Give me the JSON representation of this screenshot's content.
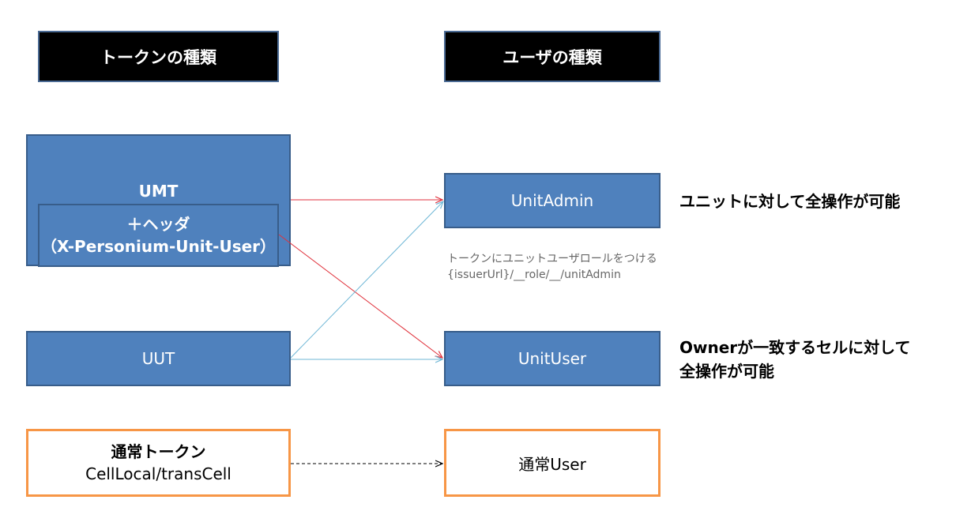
{
  "headers": {
    "token_types": "トークンの種類",
    "user_types": "ユーザの種類"
  },
  "tokens": {
    "umt": {
      "label": "UMT",
      "header_label": "＋ヘッダ",
      "header_name": "（X-Personium-Unit-User）"
    },
    "uut": {
      "label": "UUT"
    },
    "normal": {
      "label": "通常トークン",
      "sub_label": "CellLocal/transCell"
    }
  },
  "users": {
    "unit_admin": "UnitAdmin",
    "unit_user": "UnitUser",
    "normal_user": "通常User"
  },
  "descriptions": {
    "unit_admin": "ユニットに対して全操作が可能",
    "unit_user_line1": "Ownerが一致するセルに対して",
    "unit_user_line2": "全操作が可能"
  },
  "note": {
    "line1": "トークンにユニットユーザロールをつける",
    "line2": "{issuerUrl}/__role/__/unitAdmin"
  },
  "colors": {
    "blue_fill": "#4f81bd",
    "blue_border": "#385d8a",
    "orange_border": "#f79646",
    "red_arrow": "#e0323c",
    "teal_arrow": "#6fb7d6"
  }
}
